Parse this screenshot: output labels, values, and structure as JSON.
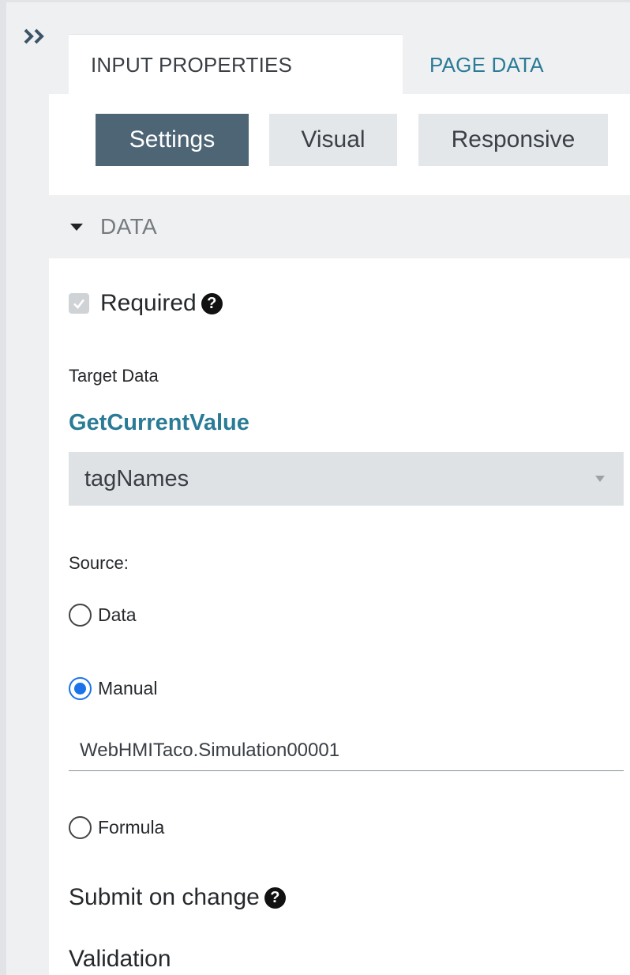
{
  "sidebar": {
    "expand_icon": "double-chevron-right-icon"
  },
  "tabs": [
    {
      "label": "INPUT PROPERTIES",
      "active": true
    },
    {
      "label": "PAGE DATA",
      "active": false
    }
  ],
  "subtabs": [
    {
      "label": "Settings",
      "active": true
    },
    {
      "label": "Visual",
      "active": false
    },
    {
      "label": "Responsive",
      "active": false
    }
  ],
  "section": {
    "title": "DATA",
    "expanded": true
  },
  "required": {
    "label": "Required",
    "checked": true,
    "help_icon": "question-circle-icon"
  },
  "target_data": {
    "label": "Target Data",
    "link": "GetCurrentValue",
    "select_value": "tagNames"
  },
  "source": {
    "label": "Source:",
    "options": [
      {
        "label": "Data",
        "selected": false
      },
      {
        "label": "Manual",
        "selected": true
      },
      {
        "label": "Formula",
        "selected": false
      }
    ],
    "manual_value": "WebHMITaco.Simulation00001"
  },
  "submit_on_change": {
    "label": "Submit on change",
    "help_icon": "question-circle-icon"
  },
  "validation": {
    "label": "Validation"
  },
  "colors": {
    "accent": "#2a7b96",
    "active_segment": "#4d6575",
    "radio_selected": "#1a73e8"
  }
}
